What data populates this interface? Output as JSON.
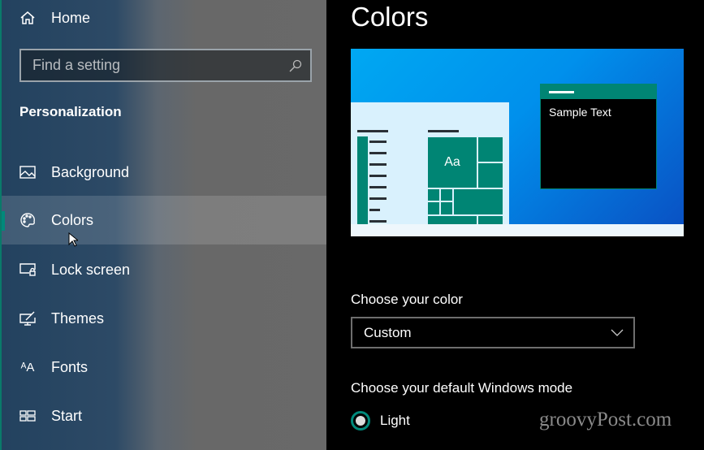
{
  "sidebar": {
    "home": "Home",
    "search_placeholder": "Find a setting",
    "section": "Personalization",
    "items": [
      {
        "label": "Background",
        "icon": "image-icon"
      },
      {
        "label": "Colors",
        "icon": "palette-icon",
        "selected": true
      },
      {
        "label": "Lock screen",
        "icon": "lock-screen-icon"
      },
      {
        "label": "Themes",
        "icon": "themes-icon"
      },
      {
        "label": "Fonts",
        "icon": "fonts-icon"
      },
      {
        "label": "Start",
        "icon": "start-icon"
      }
    ]
  },
  "main": {
    "title": "Colors",
    "preview": {
      "sample_text": "Sample Text",
      "tile_text": "Aa",
      "accent": "#008574"
    },
    "choose_color_label": "Choose your color",
    "choose_color_value": "Custom",
    "mode_label": "Choose your default Windows mode",
    "mode_option": "Light"
  },
  "watermark": "groovyPost.com"
}
